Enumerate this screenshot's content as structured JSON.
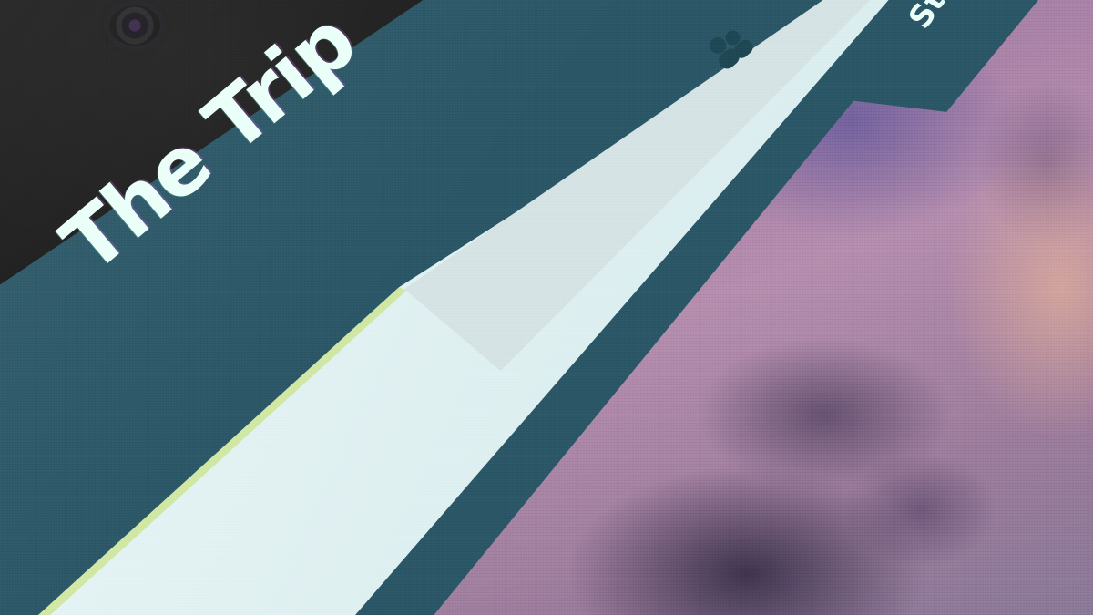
{
  "app": {
    "title": "The Trip"
  },
  "header": {
    "people_icon": "people-icon"
  },
  "banner": {
    "city": "Stockho"
  },
  "colors": {
    "header_bg": "#2b5767",
    "title_text": "#eafff9",
    "panel_light": "#dff0f1",
    "search_field": "#d6e3e4",
    "accent_edge": "#c8e27a"
  }
}
